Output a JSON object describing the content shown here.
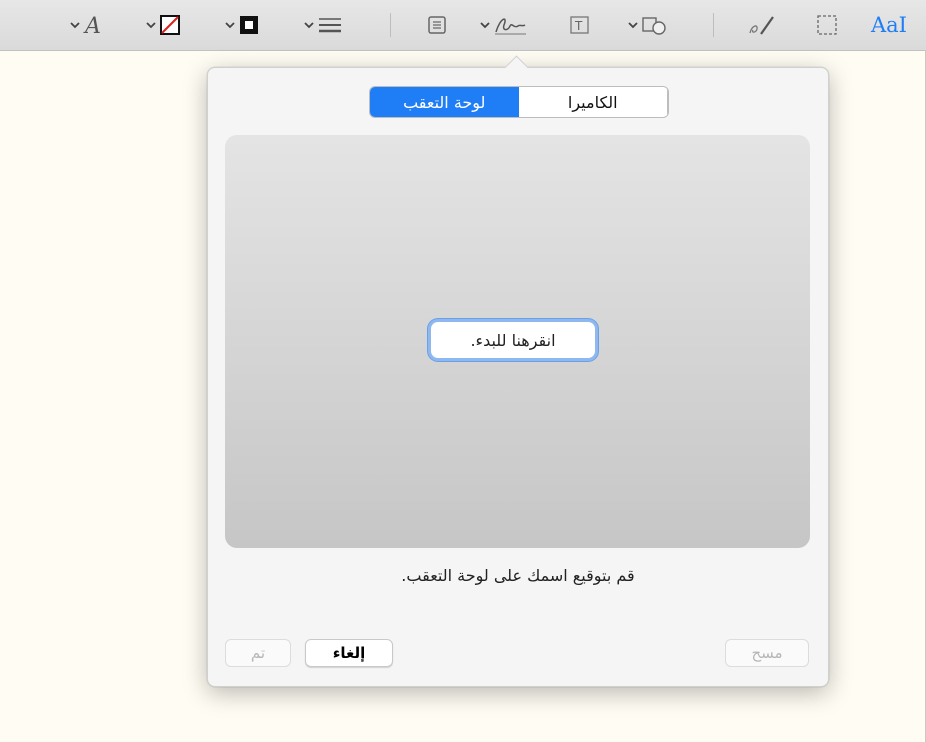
{
  "toolbar": {
    "items": [
      {
        "icon": "font-style-icon"
      },
      {
        "icon": "border-color-icon"
      },
      {
        "icon": "fill-color-icon"
      },
      {
        "icon": "line-style-icon"
      },
      {
        "icon": "note-icon"
      },
      {
        "icon": "signature-icon"
      },
      {
        "icon": "text-box-icon"
      },
      {
        "icon": "shapes-icon"
      },
      {
        "icon": "sketch-icon"
      },
      {
        "icon": "selection-rect-icon"
      },
      {
        "icon": "text-selection-icon"
      }
    ],
    "text_tool_label": "AaI",
    "accent_color": "#1f7ef5"
  },
  "signature_popover": {
    "tabs": [
      {
        "label": "لوحة التعقب",
        "active": true
      },
      {
        "label": "الكاميرا",
        "active": false
      }
    ],
    "start_button_label": "انقرهنا للبدء.",
    "instruction": "قم بتوقيع اسمك على لوحة التعقب.",
    "buttons": {
      "clear": "مسح",
      "cancel": "إلغاء",
      "done": "تم"
    }
  }
}
